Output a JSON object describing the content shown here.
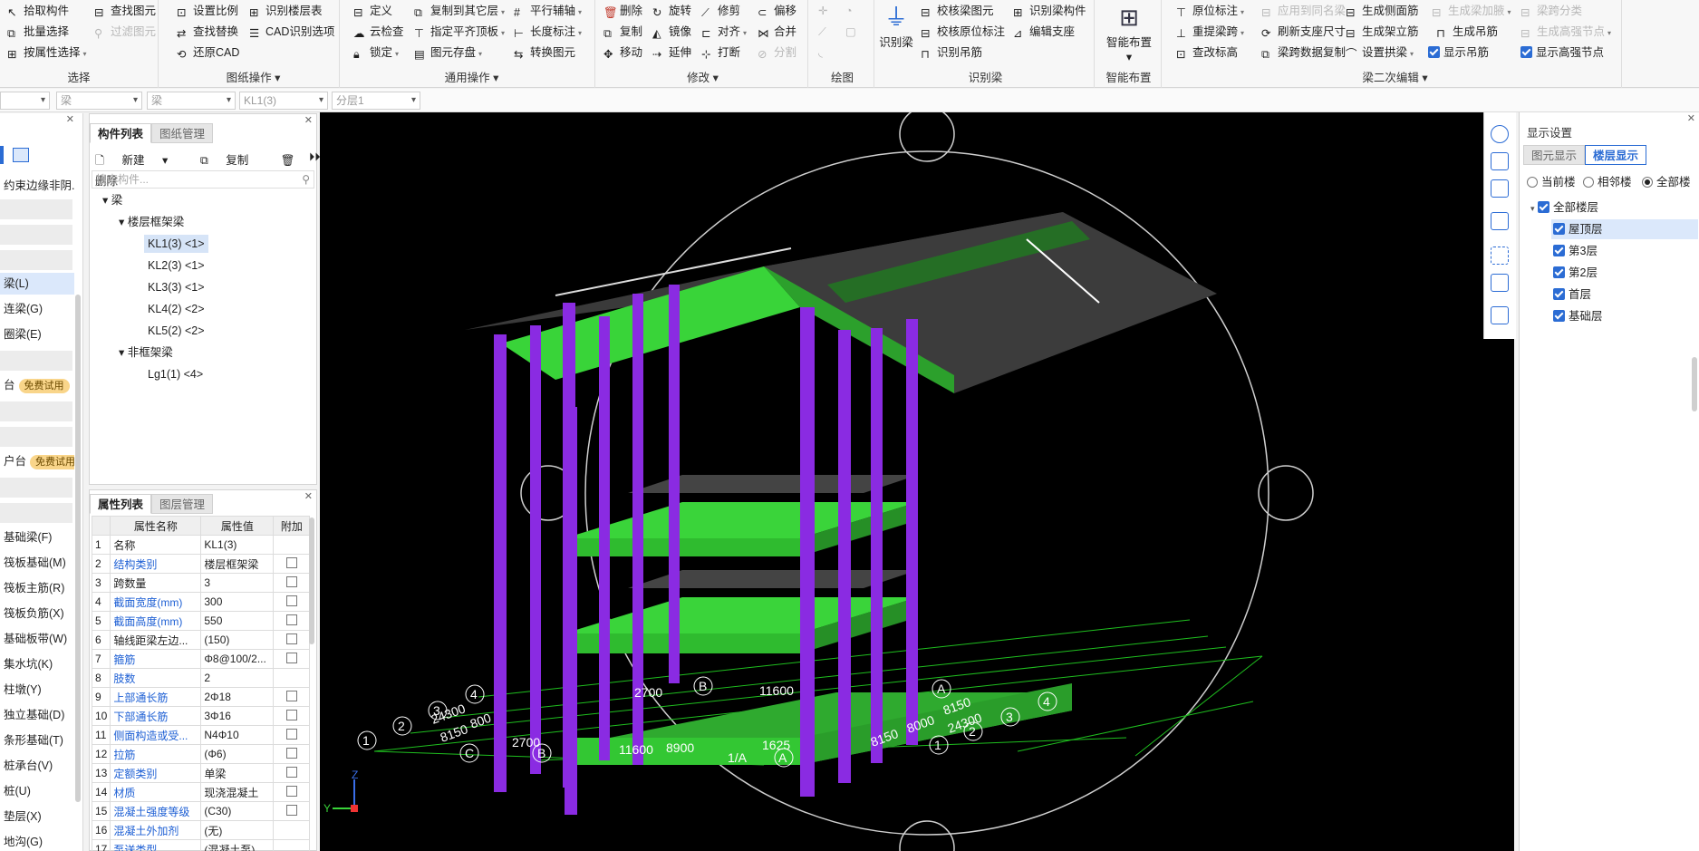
{
  "ribbon": {
    "select": {
      "label": "选择",
      "items": [
        "拾取构件",
        "批量选择",
        "按属性选择",
        "查找图元",
        "过滤图元"
      ]
    },
    "drawing_ops": {
      "label": "图纸操作",
      "items": [
        "设置比例",
        "识别楼层表",
        "查找替换",
        "CAD识别选项",
        "还原CAD"
      ]
    },
    "general_ops": {
      "label": "通用操作",
      "items": [
        "定义",
        "复制到其它层",
        "平行辅轴",
        "云检查",
        "指定平齐顶板",
        "长度标注",
        "锁定",
        "图元存盘",
        "转换图元"
      ]
    },
    "modify": {
      "label": "修改",
      "items": [
        "删除",
        "旋转",
        "修剪",
        "偏移",
        "复制",
        "镜像",
        "对齐",
        "合并",
        "移动",
        "延伸",
        "打断",
        "分割"
      ]
    },
    "draw": {
      "label": "绘图"
    },
    "recognize_beam": {
      "label": "识别梁",
      "big": "识别梁",
      "items": [
        "校核梁图元",
        "识别梁构件",
        "校核原位标注",
        "编辑支座",
        "识别吊筋"
      ]
    },
    "smart_layout": {
      "label": "智能布置",
      "big": "智能布置"
    },
    "beam_edit": {
      "label": "梁二次编辑",
      "items": [
        "原位标注",
        "应用到同名梁",
        "生成侧面筋",
        "生成梁加腋",
        "梁跨分类",
        "重提梁跨",
        "刷新支座尺寸",
        "生成架立筋",
        "生成高强节点",
        "查改标高",
        "梁跨数据复制",
        "设置拱梁",
        "显示吊筋",
        "显示高强节点"
      ]
    }
  },
  "selectors": [
    "",
    "梁",
    "梁",
    "KL1(3)",
    "分层1"
  ],
  "leftnav": {
    "items": [
      "约束边缘非阴.",
      "梁(L)",
      "连梁(G)",
      "圈梁(E)",
      "免费试用",
      "免费试用",
      "基础梁(F)",
      "筏板基础(M)",
      "筏板主筋(R)",
      "筏板负筋(X)",
      "基础板带(W)",
      "集水坑(K)",
      "柱墩(Y)",
      "独立基础(D)",
      "条形基础(T)",
      "桩承台(V)",
      "桩(U)",
      "垫层(X)",
      "地沟(G)"
    ],
    "badge_prefix_a": "台",
    "badge_prefix_b": "户台"
  },
  "component": {
    "tabs": [
      "构件列表",
      "图纸管理"
    ],
    "tools": [
      "新建",
      "复制",
      "删除"
    ],
    "search_placeholder": "搜索构件...",
    "tree": {
      "root": "梁",
      "group1": "楼层框架梁",
      "group1_items": [
        "KL1(3) <1>",
        "KL2(3) <1>",
        "KL3(3) <1>",
        "KL4(2) <2>",
        "KL5(2) <2>"
      ],
      "group2": "非框架梁",
      "group2_items": [
        "Lg1(1) <4>"
      ]
    }
  },
  "properties": {
    "tabs": [
      "属性列表",
      "图层管理"
    ],
    "headers": [
      "属性名称",
      "属性值",
      "附加"
    ],
    "rows": [
      {
        "n": "1",
        "name": "名称",
        "value": "KL1(3)",
        "blue": false,
        "chk": false
      },
      {
        "n": "2",
        "name": "结构类别",
        "value": "楼层框架梁",
        "blue": true,
        "chk": true
      },
      {
        "n": "3",
        "name": "跨数量",
        "value": "3",
        "blue": false,
        "chk": true
      },
      {
        "n": "4",
        "name": "截面宽度(mm)",
        "value": "300",
        "blue": true,
        "chk": true
      },
      {
        "n": "5",
        "name": "截面高度(mm)",
        "value": "550",
        "blue": true,
        "chk": true
      },
      {
        "n": "6",
        "name": "轴线距梁左边...",
        "value": "(150)",
        "blue": false,
        "chk": true
      },
      {
        "n": "7",
        "name": "箍筋",
        "value": "Φ8@100/2...",
        "blue": true,
        "chk": true
      },
      {
        "n": "8",
        "name": "肢数",
        "value": "2",
        "blue": true,
        "chk": false
      },
      {
        "n": "9",
        "name": "上部通长筋",
        "value": "2Φ18",
        "blue": true,
        "chk": true
      },
      {
        "n": "10",
        "name": "下部通长筋",
        "value": "3Φ16",
        "blue": true,
        "chk": true
      },
      {
        "n": "11",
        "name": "侧面构造或受...",
        "value": "N4Φ10",
        "blue": true,
        "chk": true
      },
      {
        "n": "12",
        "name": "拉筋",
        "value": "(Φ6)",
        "blue": true,
        "chk": true
      },
      {
        "n": "13",
        "name": "定额类别",
        "value": "单梁",
        "blue": true,
        "chk": true
      },
      {
        "n": "14",
        "name": "材质",
        "value": "现浇混凝土",
        "blue": true,
        "chk": true
      },
      {
        "n": "15",
        "name": "混凝土强度等级",
        "value": "(C30)",
        "blue": true,
        "chk": true
      },
      {
        "n": "16",
        "name": "混凝土外加剂",
        "value": "(无)",
        "blue": true,
        "chk": false
      },
      {
        "n": "17",
        "name": "泵送类型",
        "value": "(混凝土泵)",
        "blue": true,
        "chk": false
      }
    ]
  },
  "viewport": {
    "axis_labels": {
      "left_nums": [
        "1",
        "2",
        "3",
        "4"
      ],
      "right_nums": [
        "1",
        "2",
        "3",
        "4"
      ],
      "letters": [
        "A",
        "B",
        "C",
        "1/A",
        "A",
        "B",
        "C"
      ]
    },
    "dims": [
      "24300",
      "8150",
      "8000",
      "8150",
      "2700",
      "11600",
      "8900",
      "1625",
      "8150",
      "8000",
      "24300",
      "8150",
      "11600",
      "2700"
    ],
    "axis_x": "Y",
    "axis_z": "Z"
  },
  "display": {
    "title": "显示设置",
    "tabs": [
      "图元显示",
      "楼层显示"
    ],
    "radios": [
      "当前楼",
      "相邻楼",
      "全部楼"
    ],
    "root": "全部楼层",
    "floors": [
      "屋顶层",
      "第3层",
      "第2层",
      "首层",
      "基础层"
    ]
  },
  "colors": {
    "beam_green": "#3ad43a",
    "column_purple": "#8a2be2",
    "roof": "#3a3a3a",
    "accent": "#2b6cd4"
  }
}
